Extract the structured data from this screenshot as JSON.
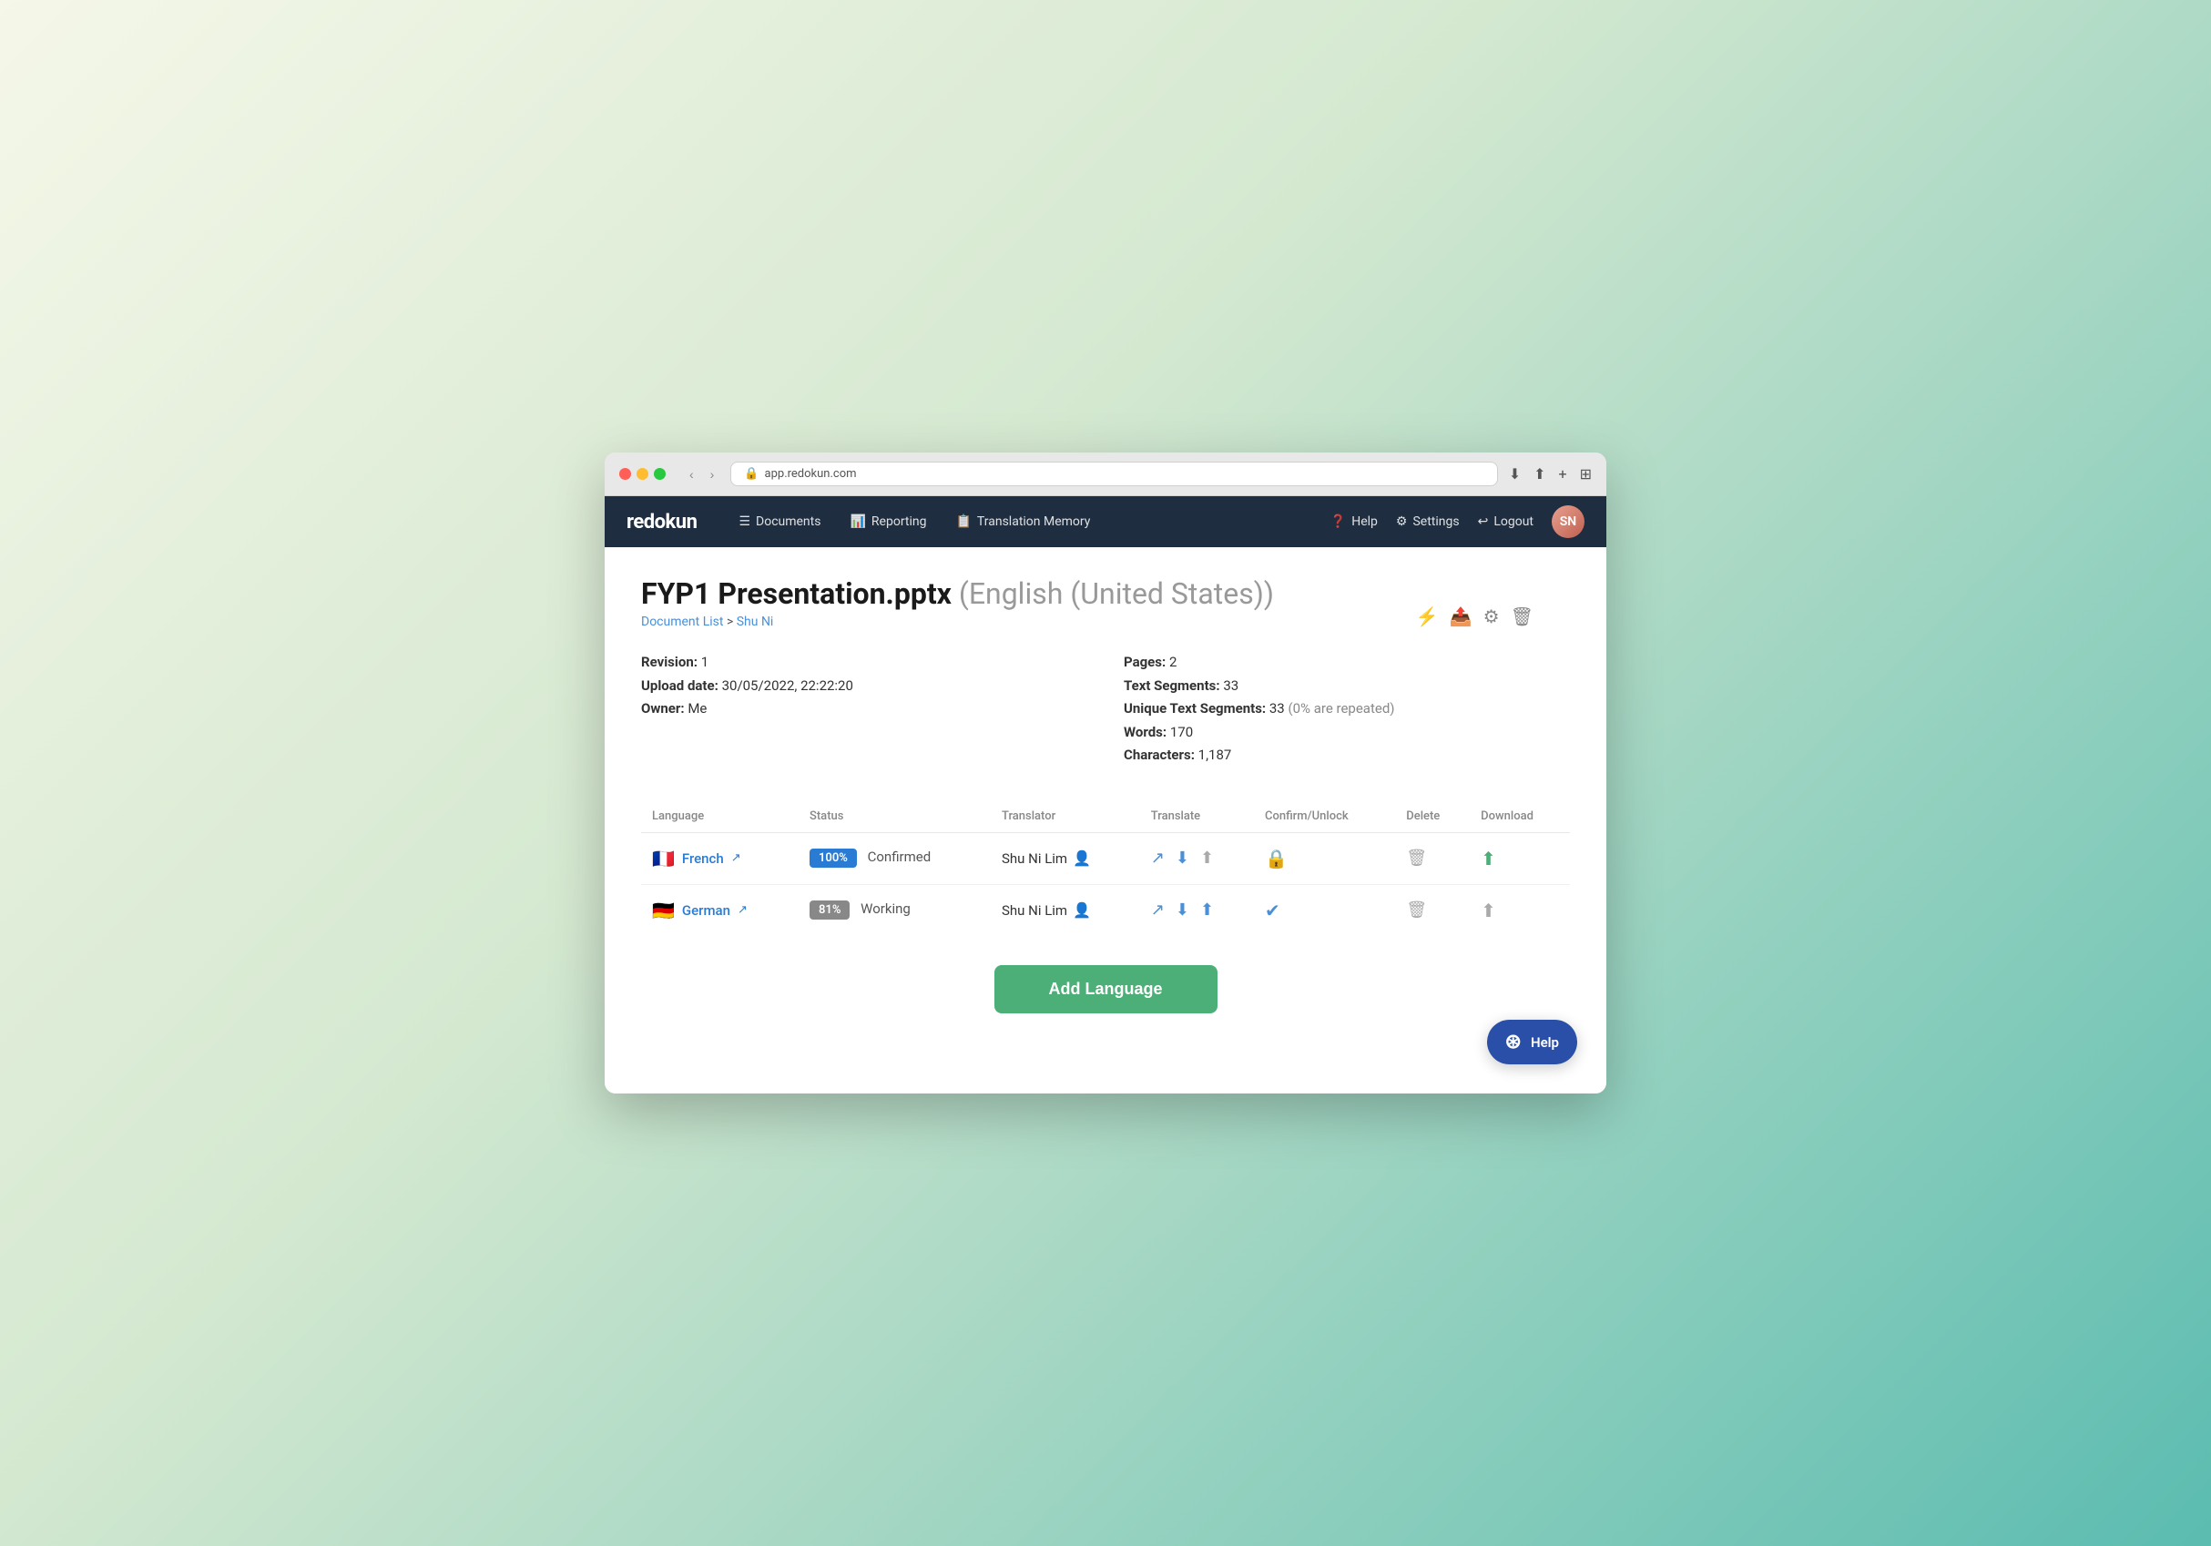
{
  "browser": {
    "url": "app.redokun.com",
    "back_label": "‹",
    "forward_label": "›"
  },
  "navbar": {
    "brand": "redokun",
    "links": [
      {
        "id": "documents",
        "icon": "☰",
        "label": "Documents"
      },
      {
        "id": "reporting",
        "icon": "📊",
        "label": "Reporting"
      },
      {
        "id": "translation-memory",
        "icon": "📋",
        "label": "Translation Memory"
      }
    ],
    "right_links": [
      {
        "id": "help",
        "icon": "❓",
        "label": "Help"
      },
      {
        "id": "settings",
        "icon": "⚙",
        "label": "Settings"
      },
      {
        "id": "logout",
        "icon": "↩",
        "label": "Logout"
      }
    ],
    "avatar_initials": "SN"
  },
  "page": {
    "title": "FYP1 Presentation.pptx",
    "title_suffix": "(English (United States))",
    "breadcrumb_list": "Document List",
    "breadcrumb_separator": ">",
    "breadcrumb_current": "Shu Ni"
  },
  "meta": {
    "revision_label": "Revision:",
    "revision_value": "1",
    "upload_date_label": "Upload date:",
    "upload_date_value": "30/05/2022, 22:22:20",
    "owner_label": "Owner:",
    "owner_value": "Me",
    "pages_label": "Pages:",
    "pages_value": "2",
    "text_segments_label": "Text Segments:",
    "text_segments_value": "33",
    "unique_segments_label": "Unique Text Segments:",
    "unique_segments_value": "33",
    "unique_segments_note": "(0% are repeated)",
    "words_label": "Words:",
    "words_value": "170",
    "characters_label": "Characters:",
    "characters_value": "1,187"
  },
  "table": {
    "headers": [
      "Language",
      "Status",
      "Translator",
      "Translate",
      "Confirm/Unlock",
      "Delete",
      "Download"
    ],
    "rows": [
      {
        "id": "french",
        "flag": "🇫🇷",
        "language": "French",
        "progress": "100%",
        "progress_color": "#2a7bd4",
        "status": "Confirmed",
        "translator": "Shu Ni Lim",
        "translate_up_active": false
      },
      {
        "id": "german",
        "flag": "🇩🇪",
        "language": "German",
        "progress": "81%",
        "progress_color": "#888",
        "status": "Working",
        "translator": "Shu Ni Lim",
        "translate_up_active": true
      }
    ]
  },
  "add_language_button": "Add Language",
  "help_button": "Help",
  "action_icons": {
    "bolt": "⚡",
    "export": "📤",
    "settings": "⚙",
    "trash": "🗑"
  }
}
